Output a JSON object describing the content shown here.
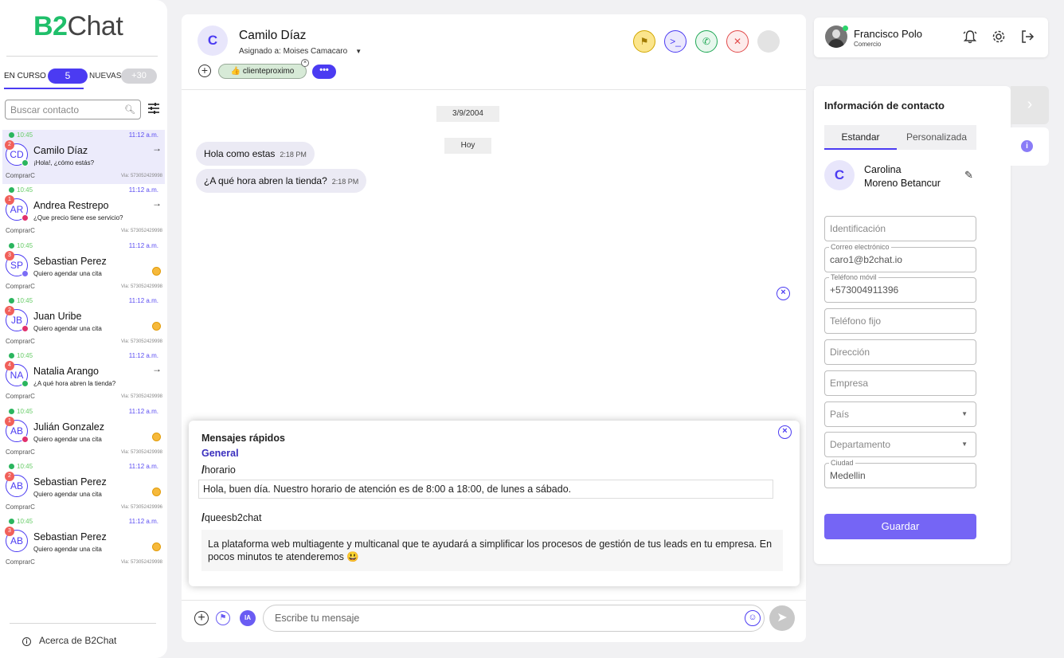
{
  "brand": {
    "logo_prefix": "B2",
    "logo_suffix": "Chat",
    "accent": "#4b3bf2",
    "green": "#1fbf6a"
  },
  "sidebar": {
    "tab_encurso": "EN CURSO",
    "tab_encurso_count": "5",
    "tab_nuevas": "NUEVAS",
    "tab_nuevas_count": "+30",
    "search_placeholder": "Buscar contacto",
    "chats": [
      {
        "time": "10:45",
        "clock": "11:12 a.m.",
        "initials": "CD",
        "badge": "2",
        "name": "Camilo Díaz",
        "message": "¡Hola!, ¿cómo estás?",
        "tag": "ComprarC",
        "via": "Via: 573052429998",
        "channel": "whatsapp",
        "status": "arrow"
      },
      {
        "time": "10:45",
        "clock": "11:12 a.m.",
        "initials": "AR",
        "badge": "1",
        "name": "Andrea Restrepo",
        "message": "¿Que precio tiene ese servicio?",
        "tag": "ComprarC",
        "via": "Via: 573052429998",
        "channel": "instagram",
        "status": "arrow"
      },
      {
        "time": "10:45",
        "clock": "11:12 a.m.",
        "initials": "SP",
        "badge": "3",
        "name": "Sebastian Perez",
        "message": "Quiero agendar una cita",
        "tag": "ComprarC",
        "via": "Via: 573052429998",
        "channel": "facebook",
        "status": "pending"
      },
      {
        "time": "10:45",
        "clock": "11:12 a.m.",
        "initials": "JB",
        "badge": "2",
        "name": "Juan Uribe",
        "message": "Quiero agendar una cita",
        "tag": "ComprarC",
        "via": "Via: 573052429998",
        "channel": "instagram",
        "status": "pending"
      },
      {
        "time": "10:45",
        "clock": "11:12 a.m.",
        "initials": "NA",
        "badge": "4",
        "name": "Natalia Arango",
        "message": "¿A qué hora abren la tienda?",
        "tag": "ComprarC",
        "via": "Via: 573052429998",
        "channel": "whatsapp",
        "status": "arrow"
      },
      {
        "time": "10:45",
        "clock": "11:12 a.m.",
        "initials": "AB",
        "badge": "1",
        "name": "Julián Gonzalez",
        "message": "Quiero agendar una cita",
        "tag": "ComprarC",
        "via": "Via: 573052429998",
        "channel": "instagram",
        "status": "pending"
      },
      {
        "time": "10:45",
        "clock": "11:12 a.m.",
        "initials": "AB",
        "badge": "2",
        "name": "Sebastian Perez",
        "message": "Quiero agendar una cita",
        "tag": "ComprarC",
        "via": "Via: 573052429996",
        "channel": "none",
        "status": "pending"
      },
      {
        "time": "10:45",
        "clock": "11:12 a.m.",
        "initials": "AB",
        "badge": "3",
        "name": "Sebastian Perez",
        "message": "Quiero agendar una cita",
        "tag": "ComprarC",
        "via": "Via: 573052429998",
        "channel": "none",
        "status": "pending"
      }
    ],
    "about": "Acerca de B2Chat"
  },
  "chat": {
    "avatar_letter": "C",
    "name": "Camilo Díaz",
    "assigned": "Asignado a: Moises Camacaro",
    "tag_chip": "👍 clienteproximo",
    "more": "•••",
    "date_chip": "3/9/2004",
    "today_chip": "Hoy",
    "messages": [
      {
        "text": "Hola como estas",
        "time": "2:18 PM"
      },
      {
        "text": "¿A qué hora abren la tienda?",
        "time": "2:18 PM"
      }
    ],
    "input_placeholder": "Escribe tu mensaje",
    "ia_label": "IA"
  },
  "quick_messages": {
    "title": "Mensajes rápidos",
    "group": "General",
    "items": [
      {
        "command": "horario",
        "text": "Hola, buen día. Nuestro horario de atención es de 8:00 a 18:00, de lunes a sábado."
      },
      {
        "command": "queesb2chat",
        "text": "La plataforma web multiagente y multicanal que te ayudará a simplificar los procesos de gestión de tus leads en tu empresa. En pocos minutos te atenderemos 😃"
      }
    ]
  },
  "user": {
    "name": "Francisco Polo",
    "role": "Comercio"
  },
  "contact": {
    "title": "Información de contacto",
    "tab_standard": "Estandar",
    "tab_custom": "Personalizada",
    "avatar_letter": "C",
    "first_name": "Carolina",
    "last_name": "Moreno Betancur",
    "fields": {
      "identificacion": "Identificación",
      "correo_label": "Correo electrónico",
      "correo_value": "caro1@b2chat.io",
      "movil_label": "Teléfono móvil",
      "movil_value": "+573004911396",
      "fijo": "Teléfono fijo",
      "direccion": "Dirección",
      "empresa": "Empresa",
      "pais": "País",
      "departamento": "Departamento",
      "ciudad_label": "Ciudad",
      "ciudad_value": "Medellin"
    },
    "save": "Guardar"
  }
}
